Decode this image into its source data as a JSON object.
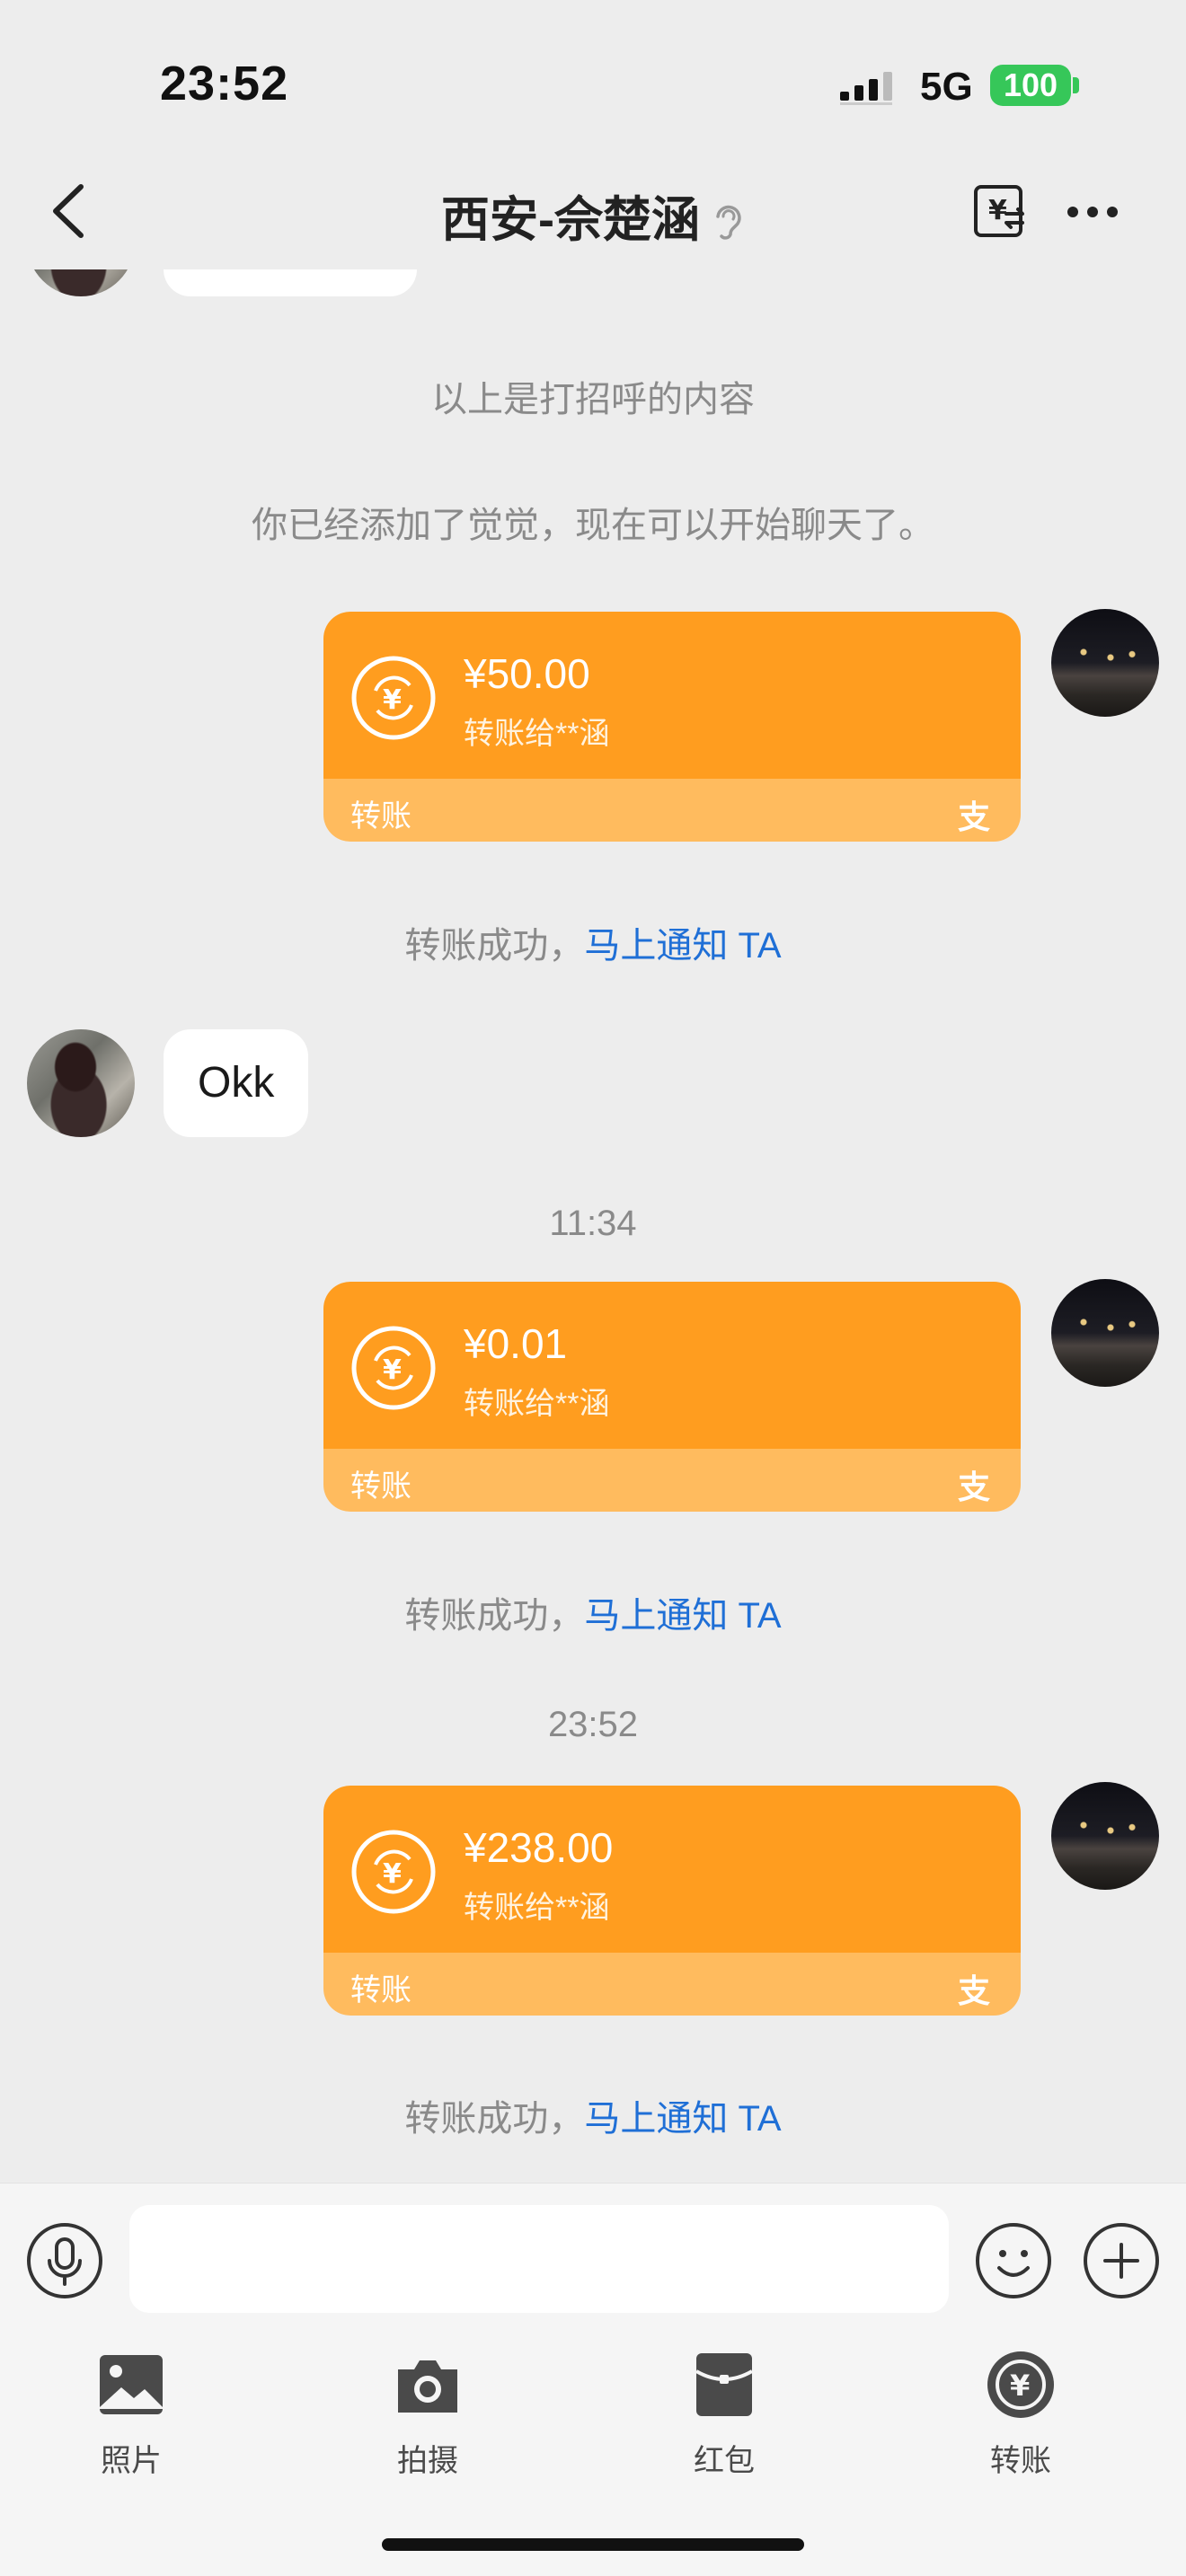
{
  "status_bar": {
    "time": "23:52",
    "network": "5G",
    "battery": "100",
    "battery_color": "#36c759"
  },
  "header": {
    "title": "西安-佘楚涵",
    "back_icon": "chevron-left-icon",
    "transfer_icon": "yuan-transfer-icon",
    "more_icon": "more-horizontal-icon"
  },
  "colors": {
    "transfer_card": "#ff9d1f",
    "transfer_card_footer": "#ffbb5e",
    "link": "#1f6fd6",
    "background": "#ededed"
  },
  "messages": {
    "greeting_note": "以上是打招呼的内容",
    "added_note": "你已经添加了觉觉，现在可以开始聊天了。",
    "transfer1": {
      "amount": "¥50.00",
      "desc": "转账给**涵",
      "label": "转账",
      "logo": "支"
    },
    "notice1": {
      "prefix": "转账成功，",
      "link": "马上通知 TA"
    },
    "her_reply": "Okk",
    "time1": "11:34",
    "transfer2": {
      "amount": "¥0.01",
      "desc": "转账给**涵",
      "label": "转账",
      "logo": "支"
    },
    "notice2": {
      "prefix": "转账成功，",
      "link": "马上通知 TA"
    },
    "time2": "23:52",
    "transfer3": {
      "amount": "¥238.00",
      "desc": "转账给**涵",
      "label": "转账",
      "logo": "支"
    },
    "notice3": {
      "prefix": "转账成功，",
      "link": "马上通知 TA"
    }
  },
  "input_bar": {
    "placeholder": "",
    "mic_icon": "microphone-icon",
    "emoji_icon": "smiley-icon",
    "plus_icon": "plus-circle-icon"
  },
  "toolbar": {
    "photos": "照片",
    "camera": "拍摄",
    "red_packet": "红包",
    "transfer": "转账"
  }
}
